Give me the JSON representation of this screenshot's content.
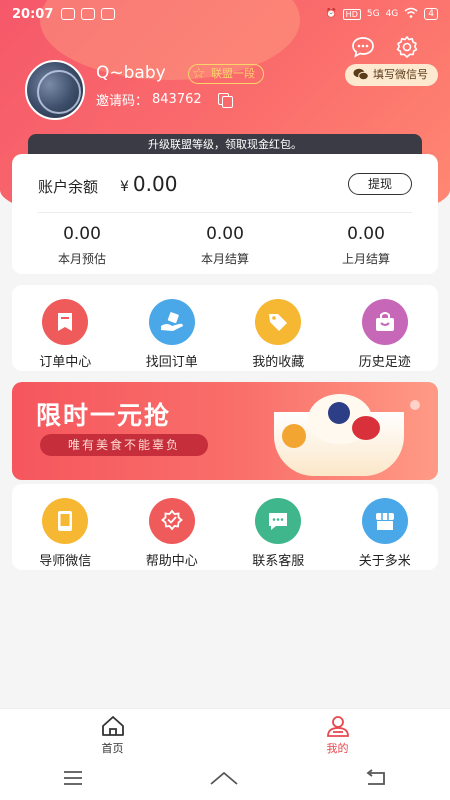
{
  "status_bar": {
    "time": "20:07",
    "net_5g": "5G",
    "net_4g": "4G",
    "hd": "HD",
    "battery": "4"
  },
  "profile": {
    "username": "Q~baby",
    "level": "联盟一段",
    "invite_label": "邀请码：",
    "invite_code": "843762",
    "wechat_button": "填写微信号"
  },
  "upgrade_banner": "升级联盟等级，领取现金红包。",
  "balance": {
    "label": "账户余额",
    "currency": "¥",
    "amount": "0.00",
    "withdraw": "提现",
    "stats": [
      {
        "value": "0.00",
        "label": "本月预估"
      },
      {
        "value": "0.00",
        "label": "本月结算"
      },
      {
        "value": "0.00",
        "label": "上月结算"
      }
    ]
  },
  "orders_grid": [
    {
      "label": "订单中心",
      "icon": "order-center-icon",
      "color": "#ef5b5b"
    },
    {
      "label": "找回订单",
      "icon": "retrieve-order-icon",
      "color": "#4aa8e8"
    },
    {
      "label": "我的收藏",
      "icon": "favorites-tag-icon",
      "color": "#f6b733"
    },
    {
      "label": "历史足迹",
      "icon": "history-bag-icon",
      "color": "#c767b8"
    }
  ],
  "promo": {
    "title": "限时一元抢",
    "subtitle": "唯有美食不能辜负"
  },
  "services_grid": [
    {
      "label": "导师微信",
      "icon": "tutor-phone-icon",
      "color": "#f6b733"
    },
    {
      "label": "帮助中心",
      "icon": "help-badge-icon",
      "color": "#ef5b5b"
    },
    {
      "label": "联系客服",
      "icon": "chat-bubble-icon",
      "color": "#3fb68b"
    },
    {
      "label": "关于多米",
      "icon": "store-icon",
      "color": "#4aa8e8"
    }
  ],
  "bottom_nav": [
    {
      "label": "首页",
      "icon": "home-icon",
      "active": false
    },
    {
      "label": "我的",
      "icon": "profile-icon",
      "active": true
    }
  ],
  "colors": {
    "accent": "#f5586a",
    "active_tab": "#e8484e"
  }
}
